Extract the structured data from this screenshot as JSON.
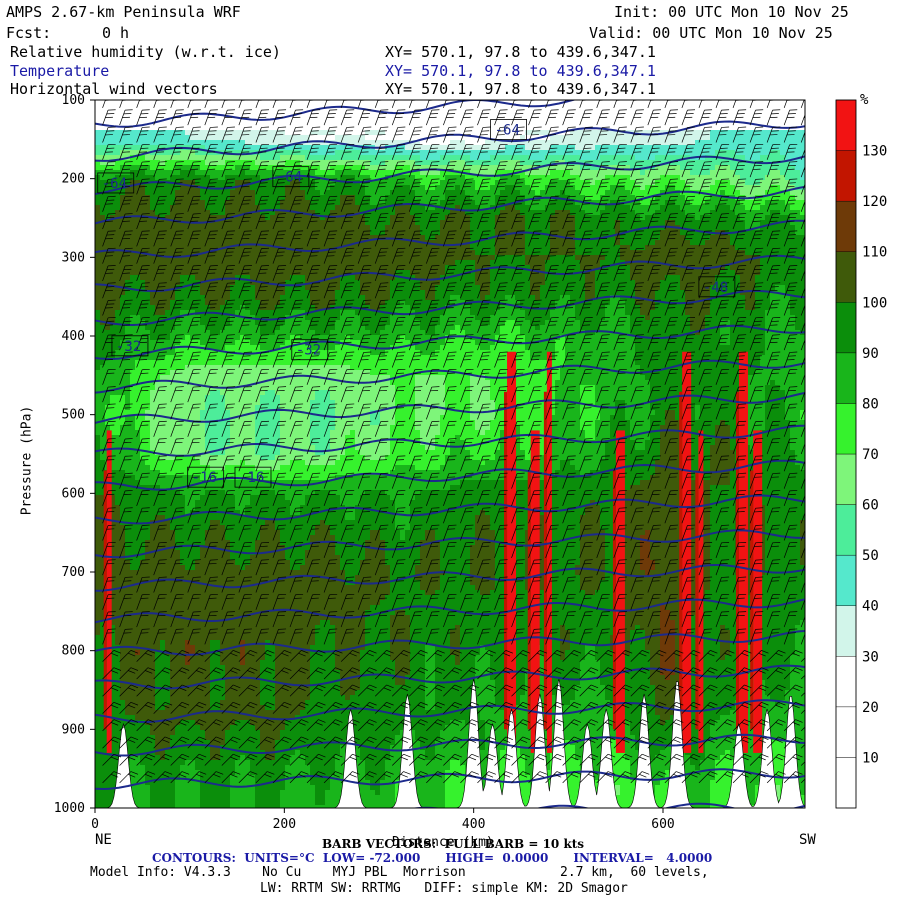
{
  "header": {
    "title": "AMPS 2.67-km Peninsula WRF",
    "fcst_label": "Fcst:",
    "fcst_value": "0 h",
    "init": "Init: 00 UTC Mon 10 Nov 25",
    "valid": "Valid: 00 UTC Mon 10 Nov 25",
    "fields": [
      {
        "name": "Relative humidity (w.r.t. ice)",
        "xy": "XY= 570.1, 97.8 to 439.6,347.1"
      },
      {
        "name": "Temperature",
        "xy": "XY= 570.1, 97.8 to 439.6,347.1"
      },
      {
        "name": "Horizontal wind vectors",
        "xy": "XY= 570.1, 97.8 to 439.6,347.1"
      }
    ]
  },
  "colors": {
    "contour": "#1c2a8c",
    "barb": "#000000",
    "title_blue": "#1a1aa6"
  },
  "chart_data": {
    "type": "heatmap",
    "xlabel": "Distance (km)",
    "ylabel": "Pressure (hPa)",
    "xlim": [
      0,
      750
    ],
    "ylim": [
      1000,
      100
    ],
    "x_ticks": [
      0,
      200,
      400,
      600
    ],
    "y_ticks": [
      100,
      200,
      300,
      400,
      500,
      600,
      700,
      800,
      900,
      1000
    ],
    "left_end_label": "NE",
    "right_end_label": "SW",
    "colorbar": {
      "unit": "%",
      "levels": [
        0,
        10,
        20,
        30,
        40,
        50,
        60,
        70,
        80,
        90,
        100,
        110,
        120,
        130,
        140
      ],
      "tick_labels": [
        10,
        20,
        30,
        40,
        50,
        60,
        70,
        80,
        90,
        100,
        110,
        120,
        130
      ],
      "colors": [
        "#ffffff",
        "#ffffff",
        "#ffffff",
        "#d2f5ea",
        "#55e8cc",
        "#4ded9a",
        "#7ef57a",
        "#36f22d",
        "#19b51b",
        "#0b8e0b",
        "#3f5a0a",
        "#6e3a08",
        "#c21500",
        "#f21313"
      ]
    },
    "temperature_contour_labels": [
      "-64",
      "-64",
      "-64",
      "-48",
      "-32",
      "-32",
      "-16",
      "-16"
    ],
    "contour_interval": 4.0,
    "rh_samples": [
      {
        "p": 150,
        "rh": [
          40,
          45,
          40,
          35,
          30,
          30,
          30,
          25,
          25,
          30,
          30,
          35,
          35,
          40,
          45,
          40
        ]
      },
      {
        "p": 200,
        "rh": [
          95,
          95,
          95,
          95,
          95,
          90,
          85,
          80,
          80,
          80,
          75,
          70,
          70,
          65,
          60,
          55
        ]
      },
      {
        "p": 250,
        "rh": [
          105,
          105,
          105,
          105,
          105,
          105,
          100,
          100,
          100,
          100,
          100,
          95,
          95,
          95,
          90,
          90
        ]
      },
      {
        "p": 300,
        "rh": [
          105,
          105,
          105,
          105,
          105,
          105,
          105,
          105,
          100,
          100,
          100,
          100,
          105,
          105,
          100,
          95
        ]
      },
      {
        "p": 350,
        "rh": [
          100,
          100,
          100,
          100,
          100,
          100,
          100,
          95,
          95,
          95,
          95,
          95,
          100,
          100,
          95,
          90
        ]
      },
      {
        "p": 400,
        "rh": [
          95,
          90,
          85,
          85,
          85,
          85,
          85,
          85,
          80,
          80,
          85,
          85,
          95,
          95,
          90,
          85
        ]
      },
      {
        "p": 450,
        "rh": [
          90,
          75,
          65,
          65,
          65,
          65,
          70,
          70,
          70,
          75,
          80,
          85,
          95,
          95,
          90,
          85
        ]
      },
      {
        "p": 500,
        "rh": [
          90,
          70,
          60,
          60,
          60,
          60,
          65,
          70,
          70,
          75,
          80,
          85,
          95,
          95,
          90,
          85
        ]
      },
      {
        "p": 550,
        "rh": [
          95,
          75,
          65,
          60,
          60,
          65,
          70,
          75,
          80,
          80,
          85,
          90,
          100,
          100,
          95,
          90
        ]
      },
      {
        "p": 600,
        "rh": [
          100,
          95,
          90,
          90,
          90,
          90,
          90,
          90,
          95,
          95,
          95,
          100,
          105,
          100,
          100,
          95
        ]
      },
      {
        "p": 700,
        "rh": [
          105,
          105,
          105,
          105,
          105,
          105,
          100,
          100,
          100,
          100,
          100,
          100,
          110,
          100,
          100,
          95
        ]
      },
      {
        "p": 800,
        "rh": [
          100,
          105,
          105,
          105,
          105,
          100,
          100,
          95,
          95,
          95,
          95,
          95,
          110,
          95,
          95,
          90
        ]
      },
      {
        "p": 900,
        "rh": [
          95,
          100,
          100,
          100,
          100,
          95,
          95,
          90,
          90,
          85,
          85,
          85,
          100,
          90,
          85,
          85
        ]
      },
      {
        "p": 975,
        "rh": [
          90,
          90,
          90,
          90,
          90,
          85,
          85,
          80,
          80,
          75,
          75,
          75,
          80,
          80,
          75,
          75
        ]
      }
    ],
    "saturated_columns_km": [
      15,
      440,
      465,
      480,
      555,
      625,
      640,
      685,
      700
    ],
    "terrain_peaks_km": [
      30,
      270,
      330,
      400,
      420,
      440,
      470,
      490,
      520,
      540,
      580,
      615,
      680,
      710,
      735
    ]
  },
  "footer": {
    "barb_line": "BARB VECTORS:  FULL BARB = 10 kts",
    "contour_line": "CONTOURS:  UNITS=°C  LOW= -72.000      HIGH=  0.0000      INTERVAL=   4.0000",
    "model_info": "Model Info: V4.3.3    No Cu    MYJ PBL  Morrison",
    "grid_info": "2.7 km,  60 levels,",
    "physics_info": "LW: RRTM SW: RRTMG   DIFF: simple KM: 2D Smagor"
  }
}
